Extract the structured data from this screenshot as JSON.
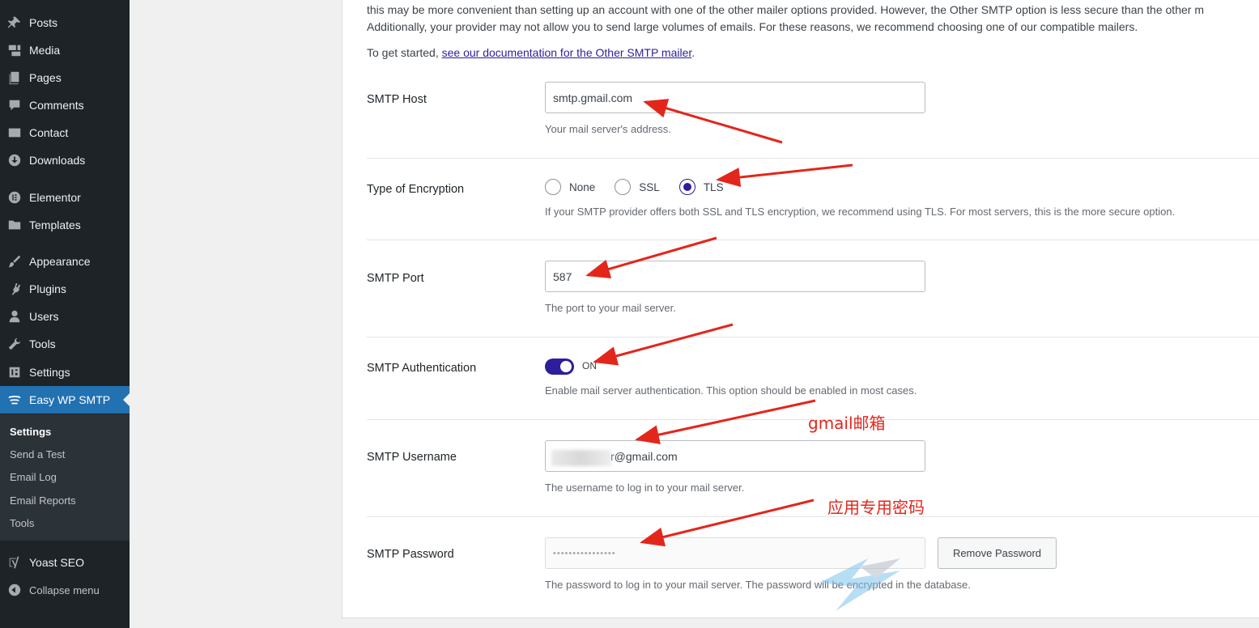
{
  "sidebar": {
    "items": [
      {
        "label": "Posts",
        "icon": "pin-icon"
      },
      {
        "label": "Media",
        "icon": "media-icon"
      },
      {
        "label": "Pages",
        "icon": "pages-icon"
      },
      {
        "label": "Comments",
        "icon": "comments-icon"
      },
      {
        "label": "Contact",
        "icon": "mail-icon"
      },
      {
        "label": "Downloads",
        "icon": "download-icon"
      },
      {
        "label": "Elementor",
        "icon": "elementor-icon"
      },
      {
        "label": "Templates",
        "icon": "folder-icon"
      },
      {
        "label": "Appearance",
        "icon": "brush-icon"
      },
      {
        "label": "Plugins",
        "icon": "plugin-icon"
      },
      {
        "label": "Users",
        "icon": "user-icon"
      },
      {
        "label": "Tools",
        "icon": "wrench-icon"
      },
      {
        "label": "Settings",
        "icon": "settings-icon"
      },
      {
        "label": "Easy WP SMTP",
        "icon": "smtp-icon"
      },
      {
        "label": "Yoast SEO",
        "icon": "yoast-icon"
      },
      {
        "label": "Collapse menu",
        "icon": "collapse-icon"
      }
    ],
    "submenu": [
      "Settings",
      "Send a Test",
      "Email Log",
      "Email Reports",
      "Tools"
    ]
  },
  "intro": {
    "line1": "this may be more convenient than setting up an account with one of the other mailer options provided. However, the Other SMTP option is less secure than the other m",
    "line2": "Additionally, your provider may not allow you to send large volumes of emails. For these reasons, we recommend choosing one of our compatible mailers.",
    "line3_prefix": "To get started, ",
    "line3_link": "see our documentation for the Other SMTP mailer",
    "line3_suffix": "."
  },
  "fields": {
    "host": {
      "label": "SMTP Host",
      "value": "smtp.gmail.com",
      "desc": "Your mail server's address."
    },
    "encryption": {
      "label": "Type of Encryption",
      "options": [
        "None",
        "SSL",
        "TLS"
      ],
      "selected": "TLS",
      "desc": "If your SMTP provider offers both SSL and TLS encryption, we recommend using TLS. For most servers, this is the more secure option."
    },
    "port": {
      "label": "SMTP Port",
      "value": "587",
      "desc": "The port to your mail server."
    },
    "auth": {
      "label": "SMTP Authentication",
      "state": "ON",
      "desc": "Enable mail server authentication. This option should be enabled in most cases."
    },
    "username": {
      "label": "SMTP Username",
      "value": "r@gmail.com",
      "desc": "The username to log in to your mail server."
    },
    "password": {
      "label": "SMTP Password",
      "value": "••••••••••••••••",
      "button": "Remove Password",
      "desc": "The password to log in to your mail server. The password will be encrypted in the database."
    }
  },
  "annotations": {
    "gmail": "gmail邮箱",
    "app_password": "应用专用密码"
  },
  "colors": {
    "accent": "#2c1e9c",
    "wp_blue": "#2271b1",
    "annotation_red": "#e3261c",
    "sidebar_bg": "#1d2327"
  }
}
